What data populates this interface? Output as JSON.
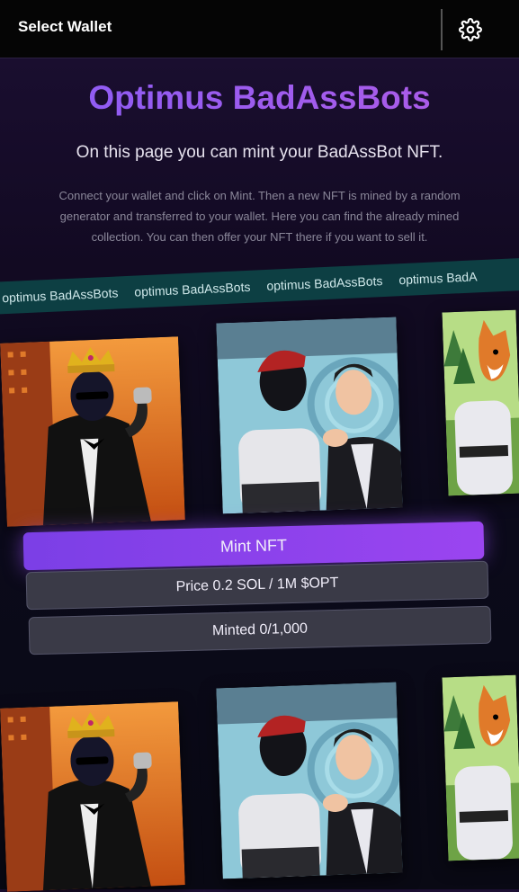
{
  "header": {
    "select_wallet_label": "Select Wallet",
    "settings_icon": "gear-icon"
  },
  "main": {
    "title": "Optimus BadAssBots",
    "subtitle": "On this page you can mint your BadAssBot NFT.",
    "description": "Connect your wallet and click on Mint. Then a new NFT is mined by a random generator and transferred to your wallet. Here you can find the already mined collection. You can then offer your NFT there if you want to sell it."
  },
  "marquee": {
    "items": [
      "optimus BadAssBots",
      "optimus BadAssBots",
      "optimus BadAssBots",
      "optimus BadA"
    ]
  },
  "mint": {
    "mint_label": "Mint NFT",
    "price_label": "Price 0.2 SOL / 1M $OPT",
    "minted_label": "Minted 0/1,000"
  },
  "colors": {
    "accent": "#8a5cf6",
    "marquee_bg": "#0d3f43",
    "button_gray": "#3a3a47"
  }
}
